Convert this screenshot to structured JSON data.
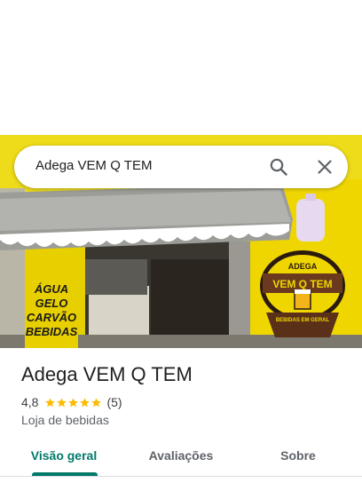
{
  "search": {
    "query": "Adega VEM Q TEM"
  },
  "photo": {
    "awning_sign_lines": [
      "ÁGUA",
      "GELO",
      "CARVÃO",
      "BEBIDAS"
    ],
    "logo_top": "ADEGA",
    "logo_main": "VEM Q TEM",
    "logo_bottom": "BEBIDAS EM GERAL"
  },
  "place": {
    "name": "Adega VEM Q TEM",
    "rating": "4,8",
    "rating_count": "(5)",
    "stars": 5,
    "category": "Loja de bebidas"
  },
  "tabs": [
    {
      "label": "Visão geral",
      "active": true
    },
    {
      "label": "Avaliações",
      "active": false
    },
    {
      "label": "Sobre",
      "active": false
    }
  ],
  "colors": {
    "accent": "#00796b",
    "star": "#fbbc04",
    "wall_yellow": "#e9d400"
  }
}
